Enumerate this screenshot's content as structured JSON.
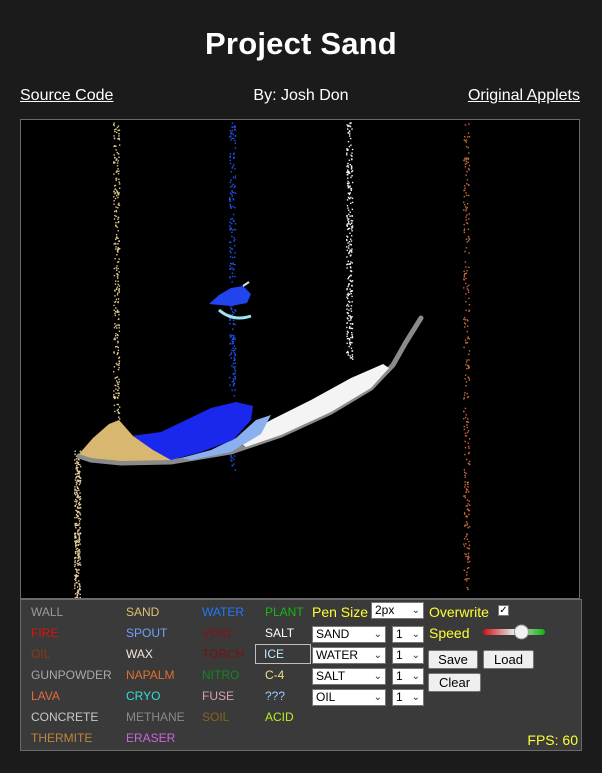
{
  "header": {
    "title": "Project Sand",
    "source_link": "Source Code",
    "author": "By: Josh Don",
    "applets_link": "Original Applets"
  },
  "elements": [
    {
      "label": "WALL",
      "color": "#9a9a9a",
      "col": 0,
      "row": 0
    },
    {
      "label": "FIRE",
      "color": "#dd1111",
      "col": 0,
      "row": 1
    },
    {
      "label": "OIL",
      "color": "#8a3a10",
      "col": 0,
      "row": 2
    },
    {
      "label": "GUNPOWDER",
      "color": "#a8a8a8",
      "col": 0,
      "row": 3
    },
    {
      "label": "LAVA",
      "color": "#e8693a",
      "col": 0,
      "row": 4
    },
    {
      "label": "CONCRETE",
      "color": "#c8c8c8",
      "col": 0,
      "row": 5
    },
    {
      "label": "THERMITE",
      "color": "#c0843a",
      "col": 0,
      "row": 6
    },
    {
      "label": "SAND",
      "color": "#e0c070",
      "col": 1,
      "row": 0
    },
    {
      "label": "SPOUT",
      "color": "#6fa0ff",
      "col": 1,
      "row": 1
    },
    {
      "label": "WAX",
      "color": "#f0e8d8",
      "col": 1,
      "row": 2
    },
    {
      "label": "NAPALM",
      "color": "#e07030",
      "col": 1,
      "row": 3
    },
    {
      "label": "CRYO",
      "color": "#33dddd",
      "col": 1,
      "row": 4
    },
    {
      "label": "METHANE",
      "color": "#8a8a8a",
      "col": 1,
      "row": 5
    },
    {
      "label": "ERASER",
      "color": "#cc66dd",
      "col": 1,
      "row": 6
    },
    {
      "label": "WATER",
      "color": "#2277ff",
      "col": 2,
      "row": 0
    },
    {
      "label": "VOID",
      "color": "#8a1111",
      "col": 2,
      "row": 1
    },
    {
      "label": "TORCH",
      "color": "#7a1010",
      "col": 2,
      "row": 2
    },
    {
      "label": "NITRO",
      "color": "#118822",
      "col": 2,
      "row": 3
    },
    {
      "label": "FUSE",
      "color": "#d8a0b0",
      "col": 2,
      "row": 4
    },
    {
      "label": "SOIL",
      "color": "#8a6020",
      "col": 2,
      "row": 5
    },
    {
      "label": "PLANT",
      "color": "#11bb11",
      "col": 3,
      "row": 0
    },
    {
      "label": "SALT",
      "color": "#ffffff",
      "col": 3,
      "row": 1
    },
    {
      "label": "ICE",
      "color": "#bde8ff",
      "col": 3,
      "row": 2,
      "selected": true
    },
    {
      "label": "C-4",
      "color": "#f0e080",
      "col": 3,
      "row": 3
    },
    {
      "label": "???",
      "color": "#99ccff",
      "col": 3,
      "row": 4
    },
    {
      "label": "ACID",
      "color": "#bbee22",
      "col": 3,
      "row": 5
    }
  ],
  "controls": {
    "pen_size_label": "Pen Size",
    "pen_size_value": "2px",
    "overwrite_label": "Overwrite",
    "overwrite_checked": true,
    "speed_label": "Speed",
    "speed_level": 0.62,
    "spouts": [
      {
        "element": "SAND",
        "rate": "1"
      },
      {
        "element": "WATER",
        "rate": "1"
      },
      {
        "element": "SALT",
        "rate": "1"
      },
      {
        "element": "OIL",
        "rate": "1"
      }
    ],
    "save_label": "Save",
    "load_label": "Load",
    "clear_label": "Clear",
    "fps_text": "FPS: 60"
  },
  "icons": {
    "dropdown": "chevron-down-icon",
    "checkbox": "check-icon"
  }
}
